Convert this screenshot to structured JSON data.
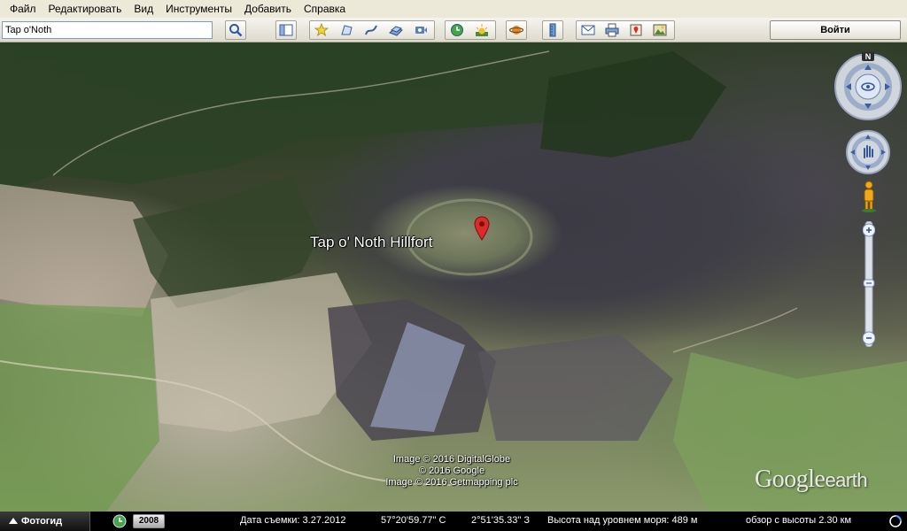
{
  "menu": {
    "items": [
      "Файл",
      "Редактировать",
      "Вид",
      "Инструменты",
      "Добавить",
      "Справка"
    ]
  },
  "toolbar": {
    "search_value": "Tap o'Noth",
    "login_label": "Войти",
    "icons": [
      "search-icon",
      "sidebar-toggle-icon",
      "add-placemark-icon",
      "add-polygon-icon",
      "add-path-icon",
      "add-image-overlay-icon",
      "record-tour-icon",
      "historical-imagery-icon",
      "sunlight-icon",
      "switch-to-planets-icon",
      "ruler-icon",
      "email-icon",
      "print-icon",
      "view-in-maps-icon",
      "save-image-icon"
    ]
  },
  "map": {
    "place_label": "Tap o' Noth Hillfort",
    "copyright": [
      "Image © 2016 DigitalGlobe",
      "© 2016 Google",
      "Image © 2016 Getmapping plc"
    ],
    "logo_google": "Google",
    "logo_earth": "earth",
    "compass_north": "N"
  },
  "status": {
    "photo_button": "Фотогид",
    "year": "2008",
    "capture_date": "Дата съемки: 3.27.2012",
    "latitude": "57°20'59.77\" С",
    "longitude": "2°51'35.33\" З",
    "elevation": "Высота над уровнем моря:   489 м",
    "eye_alt": "обзор с высоты   2.30 км"
  },
  "colors": {
    "status_bg": "#000000",
    "chrome_bg": "#ece9d8",
    "pin": "#d92b2b"
  }
}
